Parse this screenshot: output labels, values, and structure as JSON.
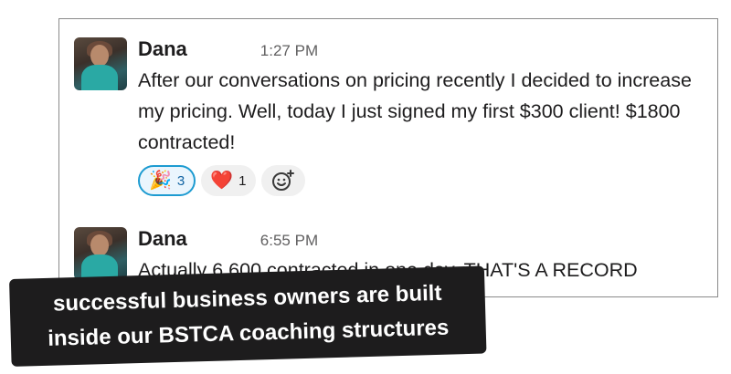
{
  "messages": [
    {
      "author": "Dana",
      "time": "1:27 PM",
      "text": "After our conversations on pricing recently I decided to increase my pricing. Well, today I just signed my first $300 client! $1800 contracted!",
      "reactions": [
        {
          "emoji": "🎉",
          "count": "3",
          "active": true
        },
        {
          "emoji": "❤️",
          "count": "1",
          "active": false
        }
      ]
    },
    {
      "author": "Dana",
      "time": "6:55 PM",
      "text": "Actually 6,600 contracted in one day. THAT'S A RECORD"
    }
  ],
  "banner": {
    "line1": "successful business owners are built",
    "line2": "inside our BSTCA coaching structures"
  },
  "colors": {
    "accent": "#1d9bd1",
    "banner_bg": "#1d1c1d"
  }
}
